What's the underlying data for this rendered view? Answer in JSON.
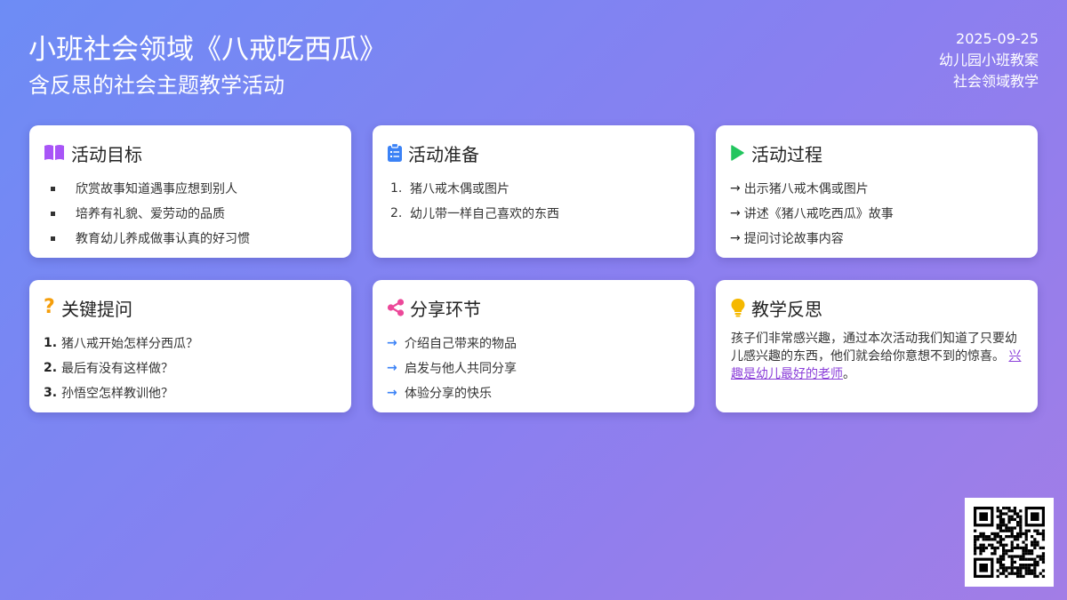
{
  "header": {
    "title": "小班社会领域《八戒吃西瓜》",
    "subtitle": "含反思的社会主题教学活动",
    "date": "2025-09-25",
    "meta1": "幼儿园小班教案",
    "meta2": "社会领域教学"
  },
  "colors": {
    "book_icon": "#a855f7",
    "clipboard_icon": "#3b82f6",
    "play_icon": "#22c55e",
    "question_icon": "#f59e0b",
    "share_icon": "#ec4899",
    "bulb_icon": "#f5b800",
    "link": "#8b3fd9"
  },
  "cards": {
    "goals": {
      "icon": "book-icon",
      "title": "活动目标",
      "items": [
        "欣赏故事知道遇事应想到别人",
        "培养有礼貌、爱劳动的品质",
        "教育幼儿养成做事认真的好习惯"
      ]
    },
    "prep": {
      "icon": "clipboard-icon",
      "title": "活动准备",
      "items": [
        "猪八戒木偶或图片",
        "幼儿带一样自己喜欢的东西"
      ]
    },
    "process": {
      "icon": "play-icon",
      "title": "活动过程",
      "items": [
        "出示猪八戒木偶或图片",
        "讲述《猪八戒吃西瓜》故事",
        "提问讨论故事内容"
      ]
    },
    "questions": {
      "icon": "question-icon",
      "title": "关键提问",
      "items": [
        "猪八戒开始怎样分西瓜？",
        "最后有没有这样做？",
        "孙悟空怎样教训他？"
      ]
    },
    "share": {
      "icon": "share-icon",
      "title": "分享环节",
      "items": [
        "介绍自己带来的物品",
        "启发与他人共同分享",
        "体验分享的快乐"
      ]
    },
    "reflection": {
      "icon": "bulb-icon",
      "title": "教学反思",
      "text": "孩子们非常感兴趣，通过本次活动我们知道了只要幼儿感兴趣的东西，他们就会给你意想不到的惊喜。",
      "link_text": "兴趣是幼儿最好的老师",
      "suffix": "。"
    }
  }
}
